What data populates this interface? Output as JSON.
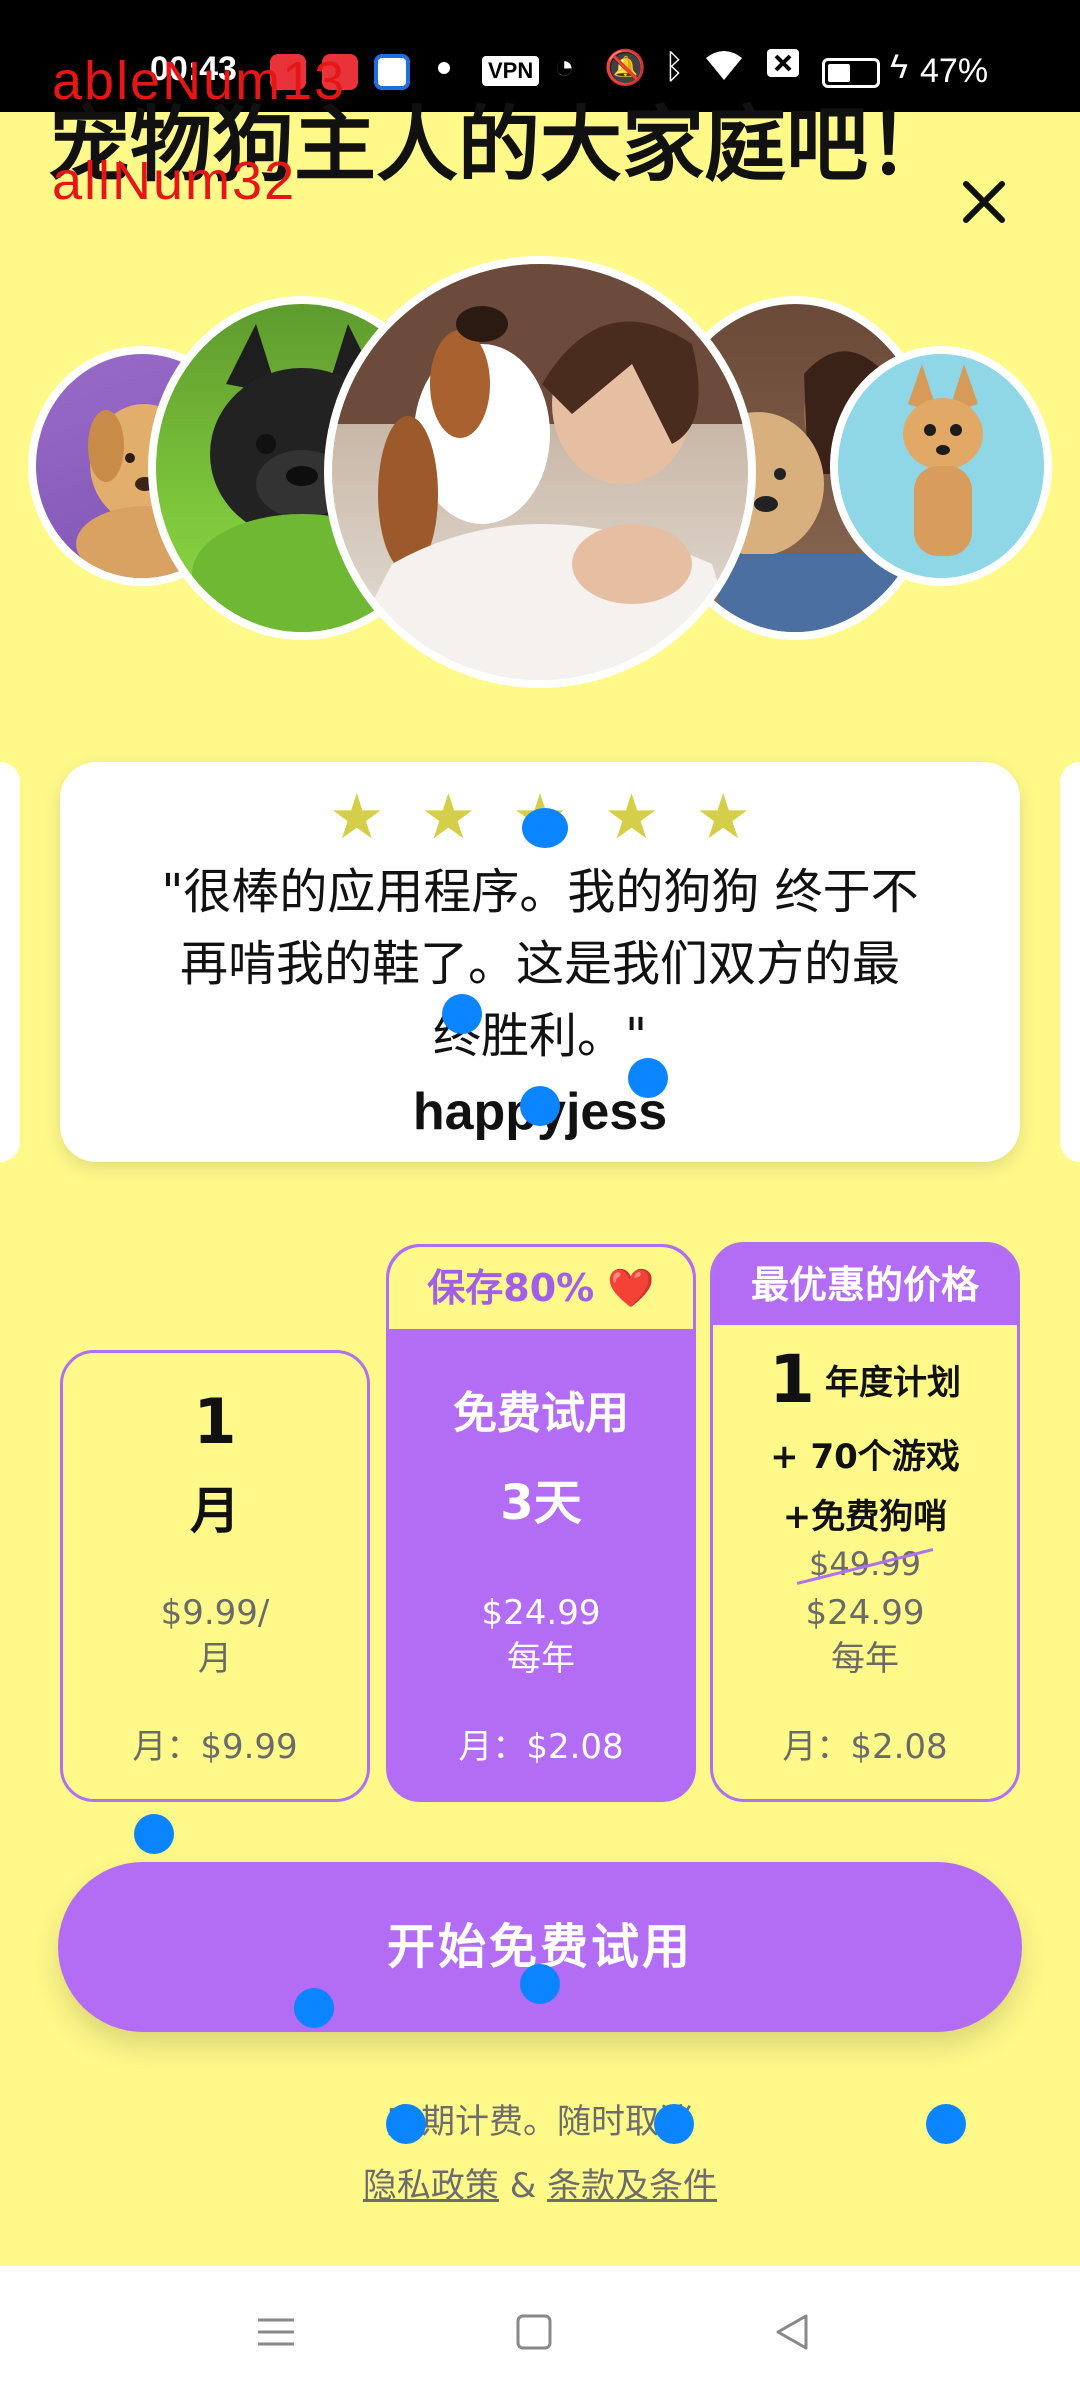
{
  "status_bar": {
    "time": "00:43",
    "vpn_label": "VPN",
    "battery_percent": "47%",
    "battery_level": 0.47,
    "icons": [
      "app-icon-red",
      "app-icon-red-2",
      "app-icon-blue",
      "dot",
      "vpn",
      "speed-icon",
      "mute-icon",
      "bluetooth-icon",
      "wifi-icon",
      "close-box-icon",
      "battery-icon",
      "charging-icon"
    ]
  },
  "overlay": {
    "label_1": "ableNum13",
    "label_2": "allNum32"
  },
  "header": {
    "title": "宠物狗主人的大家庭吧！",
    "close_icon": "close-icon"
  },
  "photos": [
    {
      "name": "labrador-puppy"
    },
    {
      "name": "french-bulldog"
    },
    {
      "name": "woman-hugging-beagle"
    },
    {
      "name": "woman-with-labrador"
    },
    {
      "name": "chihuahua"
    }
  ],
  "review": {
    "stars": 5,
    "star_glyph": "★",
    "quote_lines": [
      "\"很棒的应用程序。我的狗狗 终于不",
      "再啃我的鞋了。这是我们双方的最",
      "终胜利。\""
    ],
    "author": "happyjess"
  },
  "plans": {
    "monthly": {
      "big": "1",
      "unit": "月",
      "price_line1": "$9.99/",
      "price_line2": "月",
      "per_month": "月：$9.99"
    },
    "trial": {
      "badge": "保存80% ❤️",
      "title": "免费试用",
      "days": "3天",
      "price": "$24.99",
      "period": "每年",
      "per_month": "月：$2.08"
    },
    "annual": {
      "badge": "最优惠的价格",
      "number": "1",
      "plan_label": "年度计划",
      "games": "+ 70个游戏",
      "whistle": "+免费狗哨",
      "old_price": "$49.99",
      "price": "$24.99",
      "period": "每年",
      "per_month": "月：$2.08"
    }
  },
  "cta": {
    "label": "开始免费试用"
  },
  "footer": {
    "billing_note": "定期计费。随时取消",
    "privacy_link": "隐私政策",
    "and": "&",
    "terms_link": "条款及条件"
  },
  "nav": {
    "menu_icon": "menu-icon",
    "home_icon": "home-square-icon",
    "back_icon": "back-triangle-icon"
  },
  "colors": {
    "background": "#FFF98A",
    "accent": "#B36DF5",
    "star": "#D4CE48",
    "touch_marker": "#0A84FF"
  }
}
